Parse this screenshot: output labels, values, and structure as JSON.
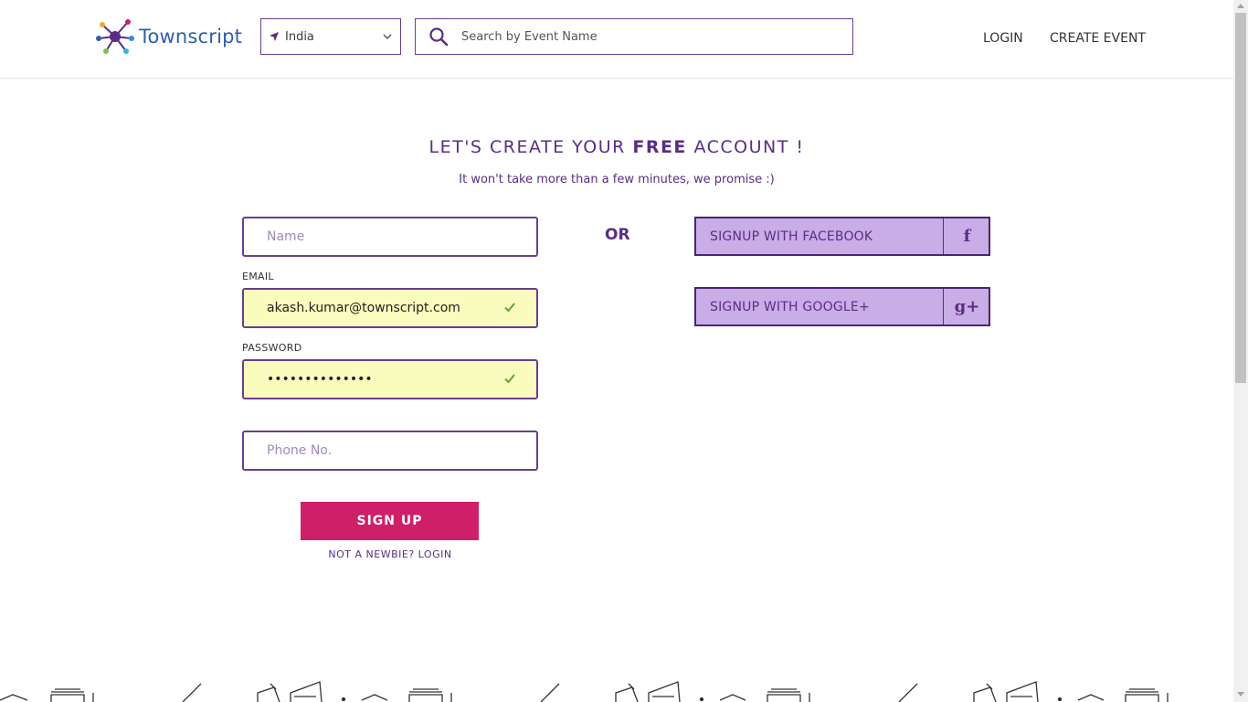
{
  "header": {
    "logo_text": "Townscript",
    "location": "India",
    "search_placeholder": "Search by Event Name",
    "nav": {
      "login": "LOGIN",
      "create_event": "CREATE EVENT"
    }
  },
  "headline": {
    "prefix": "LET'S CREATE YOUR ",
    "bold": "FREE",
    "suffix": " ACCOUNT !"
  },
  "subline": "It won't take more than a few minutes, we promise :)",
  "form": {
    "name_placeholder": "Name",
    "email_label": "EMAIL",
    "email_value": "akash.kumar@townscript.com",
    "password_label": "PASSWORD",
    "password_value": "••••••••••••••",
    "phone_placeholder": "Phone No.",
    "signup_label": "SIGN UP",
    "newbie_link": "NOT A NEWBIE? LOGIN"
  },
  "or_label": "OR",
  "social": {
    "facebook_label": "SIGNUP WITH FACEBOOK",
    "facebook_icon": "f",
    "google_label": "SIGNUP WITH GOOGLE+",
    "google_icon": "g+"
  },
  "colors": {
    "brand_purple": "#5b2c83",
    "accent_pink": "#cf1f68",
    "social_bg": "#c9ade6",
    "valid_bg": "#fafcbe",
    "logo_blue": "#2f5fa8"
  }
}
